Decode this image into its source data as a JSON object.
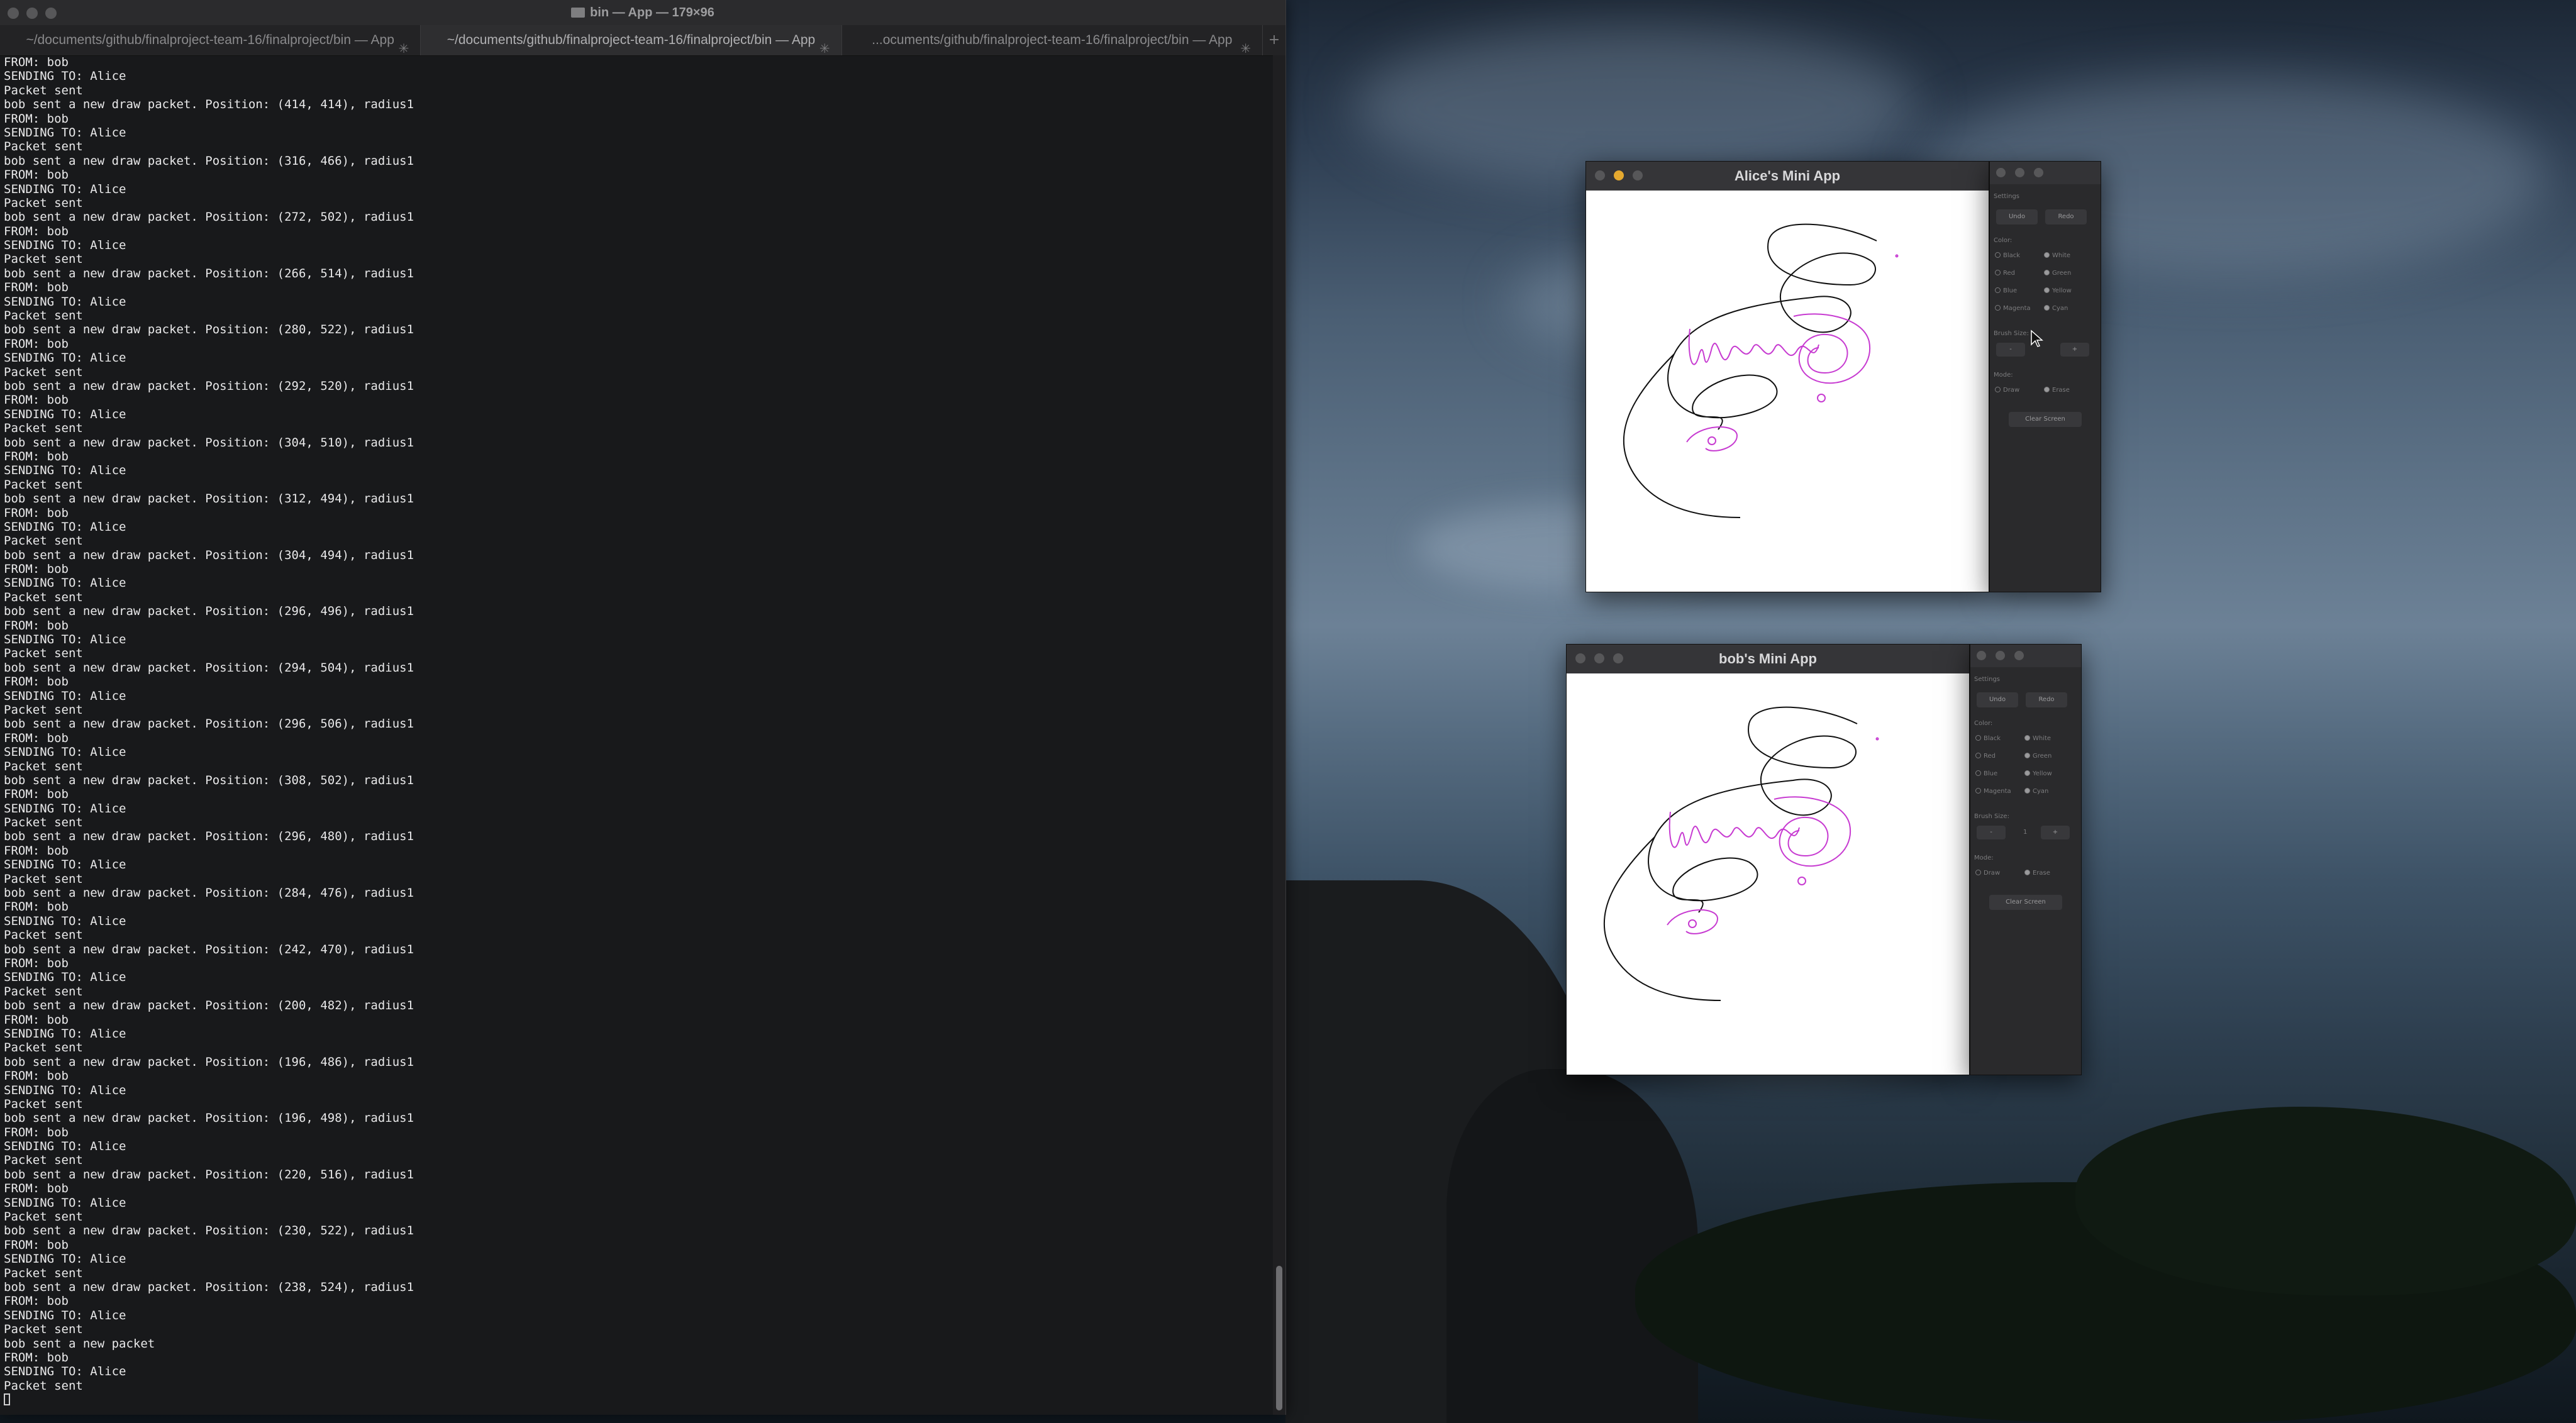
{
  "terminal": {
    "title": "bin — App — 179×96",
    "tabs": [
      {
        "label": "~/documents/github/finalproject-team-16/finalproject/bin — App"
      },
      {
        "label": "~/documents/github/finalproject-team-16/finalproject/bin — App"
      },
      {
        "label": "...ocuments/github/finalproject-team-16/finalproject/bin — App"
      }
    ],
    "add_tab": "+",
    "lines": [
      "FROM: bob",
      "SENDING TO: Alice",
      "Packet sent",
      "bob sent a new draw packet. Position: (414, 414), radius1",
      "FROM: bob",
      "SENDING TO: Alice",
      "Packet sent",
      "bob sent a new draw packet. Position: (316, 466), radius1",
      "FROM: bob",
      "SENDING TO: Alice",
      "Packet sent",
      "bob sent a new draw packet. Position: (272, 502), radius1",
      "FROM: bob",
      "SENDING TO: Alice",
      "Packet sent",
      "bob sent a new draw packet. Position: (266, 514), radius1",
      "FROM: bob",
      "SENDING TO: Alice",
      "Packet sent",
      "bob sent a new draw packet. Position: (280, 522), radius1",
      "FROM: bob",
      "SENDING TO: Alice",
      "Packet sent",
      "bob sent a new draw packet. Position: (292, 520), radius1",
      "FROM: bob",
      "SENDING TO: Alice",
      "Packet sent",
      "bob sent a new draw packet. Position: (304, 510), radius1",
      "FROM: bob",
      "SENDING TO: Alice",
      "Packet sent",
      "bob sent a new draw packet. Position: (312, 494), radius1",
      "FROM: bob",
      "SENDING TO: Alice",
      "Packet sent",
      "bob sent a new draw packet. Position: (304, 494), radius1",
      "FROM: bob",
      "SENDING TO: Alice",
      "Packet sent",
      "bob sent a new draw packet. Position: (296, 496), radius1",
      "FROM: bob",
      "SENDING TO: Alice",
      "Packet sent",
      "bob sent a new draw packet. Position: (294, 504), radius1",
      "FROM: bob",
      "SENDING TO: Alice",
      "Packet sent",
      "bob sent a new draw packet. Position: (296, 506), radius1",
      "FROM: bob",
      "SENDING TO: Alice",
      "Packet sent",
      "bob sent a new draw packet. Position: (308, 502), radius1",
      "FROM: bob",
      "SENDING TO: Alice",
      "Packet sent",
      "bob sent a new draw packet. Position: (296, 480), radius1",
      "FROM: bob",
      "SENDING TO: Alice",
      "Packet sent",
      "bob sent a new draw packet. Position: (284, 476), radius1",
      "FROM: bob",
      "SENDING TO: Alice",
      "Packet sent",
      "bob sent a new draw packet. Position: (242, 470), radius1",
      "FROM: bob",
      "SENDING TO: Alice",
      "Packet sent",
      "bob sent a new draw packet. Position: (200, 482), radius1",
      "FROM: bob",
      "SENDING TO: Alice",
      "Packet sent",
      "bob sent a new draw packet. Position: (196, 486), radius1",
      "FROM: bob",
      "SENDING TO: Alice",
      "Packet sent",
      "bob sent a new draw packet. Position: (196, 498), radius1",
      "FROM: bob",
      "SENDING TO: Alice",
      "Packet sent",
      "bob sent a new draw packet. Position: (220, 516), radius1",
      "FROM: bob",
      "SENDING TO: Alice",
      "Packet sent",
      "bob sent a new draw packet. Position: (230, 522), radius1",
      "FROM: bob",
      "SENDING TO: Alice",
      "Packet sent",
      "bob sent a new draw packet. Position: (238, 524), radius1",
      "FROM: bob",
      "SENDING TO: Alice",
      "Packet sent",
      "bob sent a new packet",
      "FROM: bob",
      "SENDING TO: Alice",
      "Packet sent"
    ]
  },
  "alice_window": {
    "title": "Alice's Mini App"
  },
  "bob_window": {
    "title": "bob's Mini App"
  },
  "settings_panel": {
    "heading": "Settings",
    "undo_label": "Undo",
    "redo_label": "Redo",
    "color_heading": "Color:",
    "colors": [
      "Black",
      "White",
      "Red",
      "Green",
      "Blue",
      "Yellow",
      "Magenta",
      "Cyan"
    ],
    "brush_heading": "Brush Size:",
    "brush_minus": "-",
    "brush_plus": "+",
    "brush_value": "1",
    "mode_heading": "Mode:",
    "modes": [
      "Draw",
      "Erase"
    ],
    "clear_label": "Clear Screen"
  },
  "colors": {
    "stroke_black": "#111111",
    "stroke_magenta": "#c73bd1",
    "terminal_bg": "#18191b"
  }
}
